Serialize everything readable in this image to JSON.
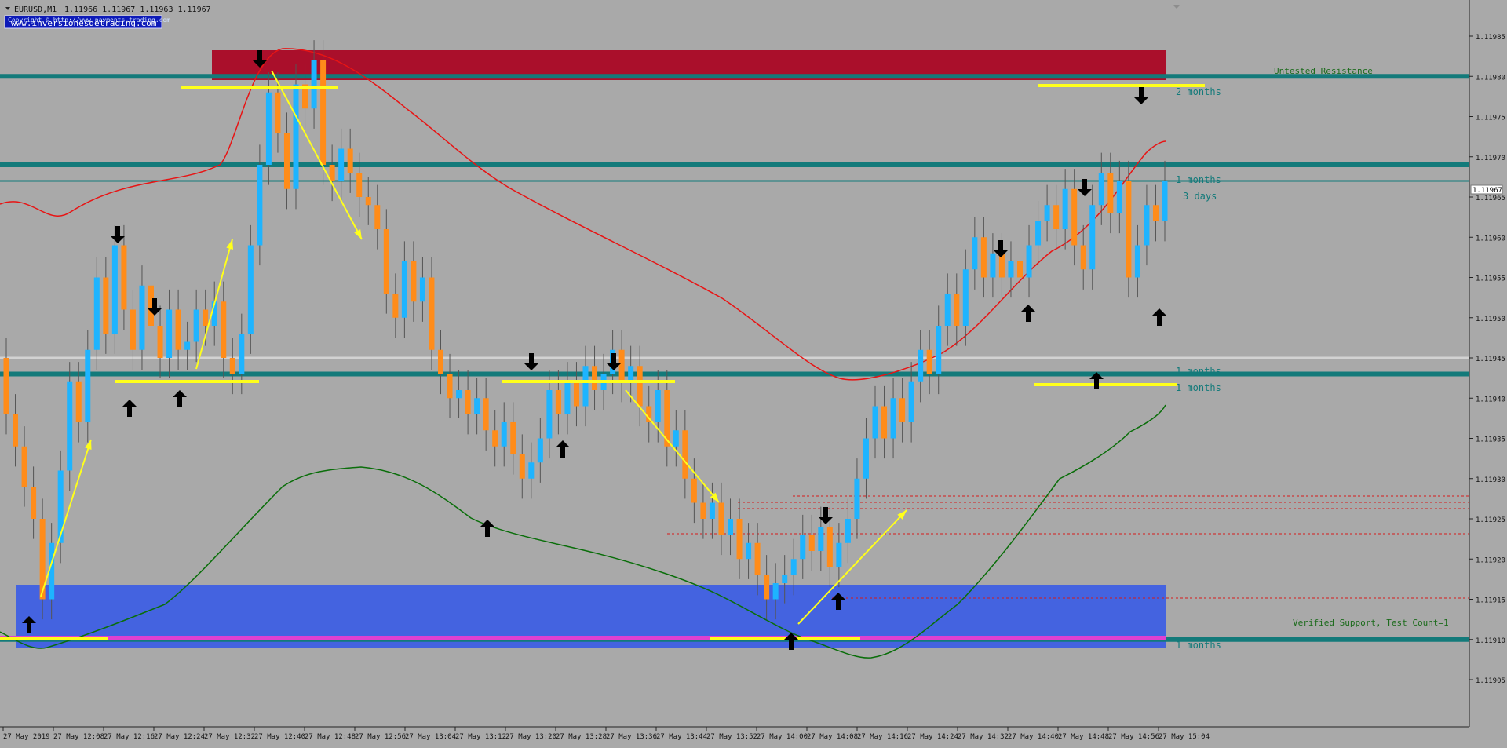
{
  "window": {
    "title": "EURUSD,M1",
    "ohlc": "1.11966 1.11967 1.11963 1.11967"
  },
  "overlay": {
    "copyright": "Copyright © http://www.payments-trading.com",
    "website": "www.inversionesdetrading.com"
  },
  "colors": {
    "background": "#a9a9a9",
    "bull_candle": "#1eb4ff",
    "bear_candle": "#ff8c1a",
    "resistance_zone": "#aa0f2b",
    "support_zone": "#4463e0",
    "teal_level": "#137a7a",
    "magenta_level": "#e040d0",
    "upper_band": "#e81414",
    "lower_band": "#0a6e0a",
    "trend_lines": "#ffff1a"
  },
  "price_axis": {
    "labels": [
      "1.11985",
      "1.11980",
      "1.11975",
      "1.11970",
      "1.11965",
      "1.11960",
      "1.11955",
      "1.11950",
      "1.11945",
      "1.11940",
      "1.11935",
      "1.11930",
      "1.11925",
      "1.11920",
      "1.11915",
      "1.11910",
      "1.11905"
    ],
    "current_price": "1.11967"
  },
  "time_axis": {
    "labels": [
      "27 May 2019",
      "27 May 12:08",
      "27 May 12:16",
      "27 May 12:24",
      "27 May 12:32",
      "27 May 12:40",
      "27 May 12:48",
      "27 May 12:56",
      "27 May 13:04",
      "27 May 13:12",
      "27 May 13:20",
      "27 May 13:28",
      "27 May 13:36",
      "27 May 13:44",
      "27 May 13:52",
      "27 May 14:00",
      "27 May 14:08",
      "27 May 14:16",
      "27 May 14:24",
      "27 May 14:32",
      "27 May 14:40",
      "27 May 14:48",
      "27 May 14:56",
      "27 May 15:04"
    ]
  },
  "levels": [
    {
      "label": "2 months",
      "price": 1.1198
    },
    {
      "label": "1 months",
      "price": 1.11969
    },
    {
      "label": "3 days",
      "price": 1.11967
    },
    {
      "label": "1 months",
      "price": 1.11945
    },
    {
      "label": "1 months",
      "price": 1.11943
    },
    {
      "label": "1 months",
      "price": 1.1191
    }
  ],
  "zones": {
    "resistance": {
      "label": "Untested Resistance",
      "from": 1.1198,
      "to": 1.11984
    },
    "support": {
      "label": "Verified Support, Test Count=1",
      "from": 1.1191,
      "to": 1.11918
    }
  },
  "chart_data": {
    "type": "candlestick",
    "symbol": "EURUSD",
    "timeframe": "M1",
    "x_start": "27 May 2019 12:00",
    "x_end": "27 May 15:04",
    "ylim": [
      1.11902,
      1.11988
    ],
    "bar_closes": [
      1.11938,
      1.11934,
      1.11929,
      1.11925,
      1.11915,
      1.11922,
      1.11931,
      1.11942,
      1.11937,
      1.11946,
      1.11955,
      1.11948,
      1.11959,
      1.11951,
      1.11946,
      1.11954,
      1.11949,
      1.11945,
      1.11951,
      1.11946,
      1.11947,
      1.11951,
      1.11949,
      1.11952,
      1.11945,
      1.11943,
      1.11948,
      1.11959,
      1.11969,
      1.11978,
      1.11973,
      1.11966,
      1.11979,
      1.11976,
      1.11982,
      1.11969,
      1.11967,
      1.11971,
      1.11968,
      1.11965,
      1.11964,
      1.11961,
      1.11953,
      1.1195,
      1.11957,
      1.11952,
      1.11955,
      1.11946,
      1.11943,
      1.1194,
      1.11941,
      1.11938,
      1.1194,
      1.11936,
      1.11934,
      1.11937,
      1.11933,
      1.1193,
      1.11932,
      1.11935,
      1.11941,
      1.11938,
      1.11942,
      1.11939,
      1.11944,
      1.11941,
      1.11943,
      1.11946,
      1.11942,
      1.11944,
      1.11939,
      1.11937,
      1.11941,
      1.11934,
      1.11936,
      1.1193,
      1.11927,
      1.11925,
      1.11927,
      1.11923,
      1.11925,
      1.1192,
      1.11922,
      1.11918,
      1.11915,
      1.11917,
      1.11918,
      1.1192,
      1.11923,
      1.11921,
      1.11924,
      1.11919,
      1.11922,
      1.11925,
      1.1193,
      1.11935,
      1.11939,
      1.11935,
      1.1194,
      1.11937,
      1.11942,
      1.11946,
      1.11943,
      1.11949,
      1.11953,
      1.11949,
      1.11956,
      1.1196,
      1.11955,
      1.11958,
      1.11955,
      1.11957,
      1.11955,
      1.11959,
      1.11962,
      1.11964,
      1.11961,
      1.11966,
      1.11959,
      1.11956,
      1.11964,
      1.11968,
      1.11963,
      1.11967,
      1.11955,
      1.11959,
      1.11964,
      1.11962,
      1.11967
    ]
  }
}
